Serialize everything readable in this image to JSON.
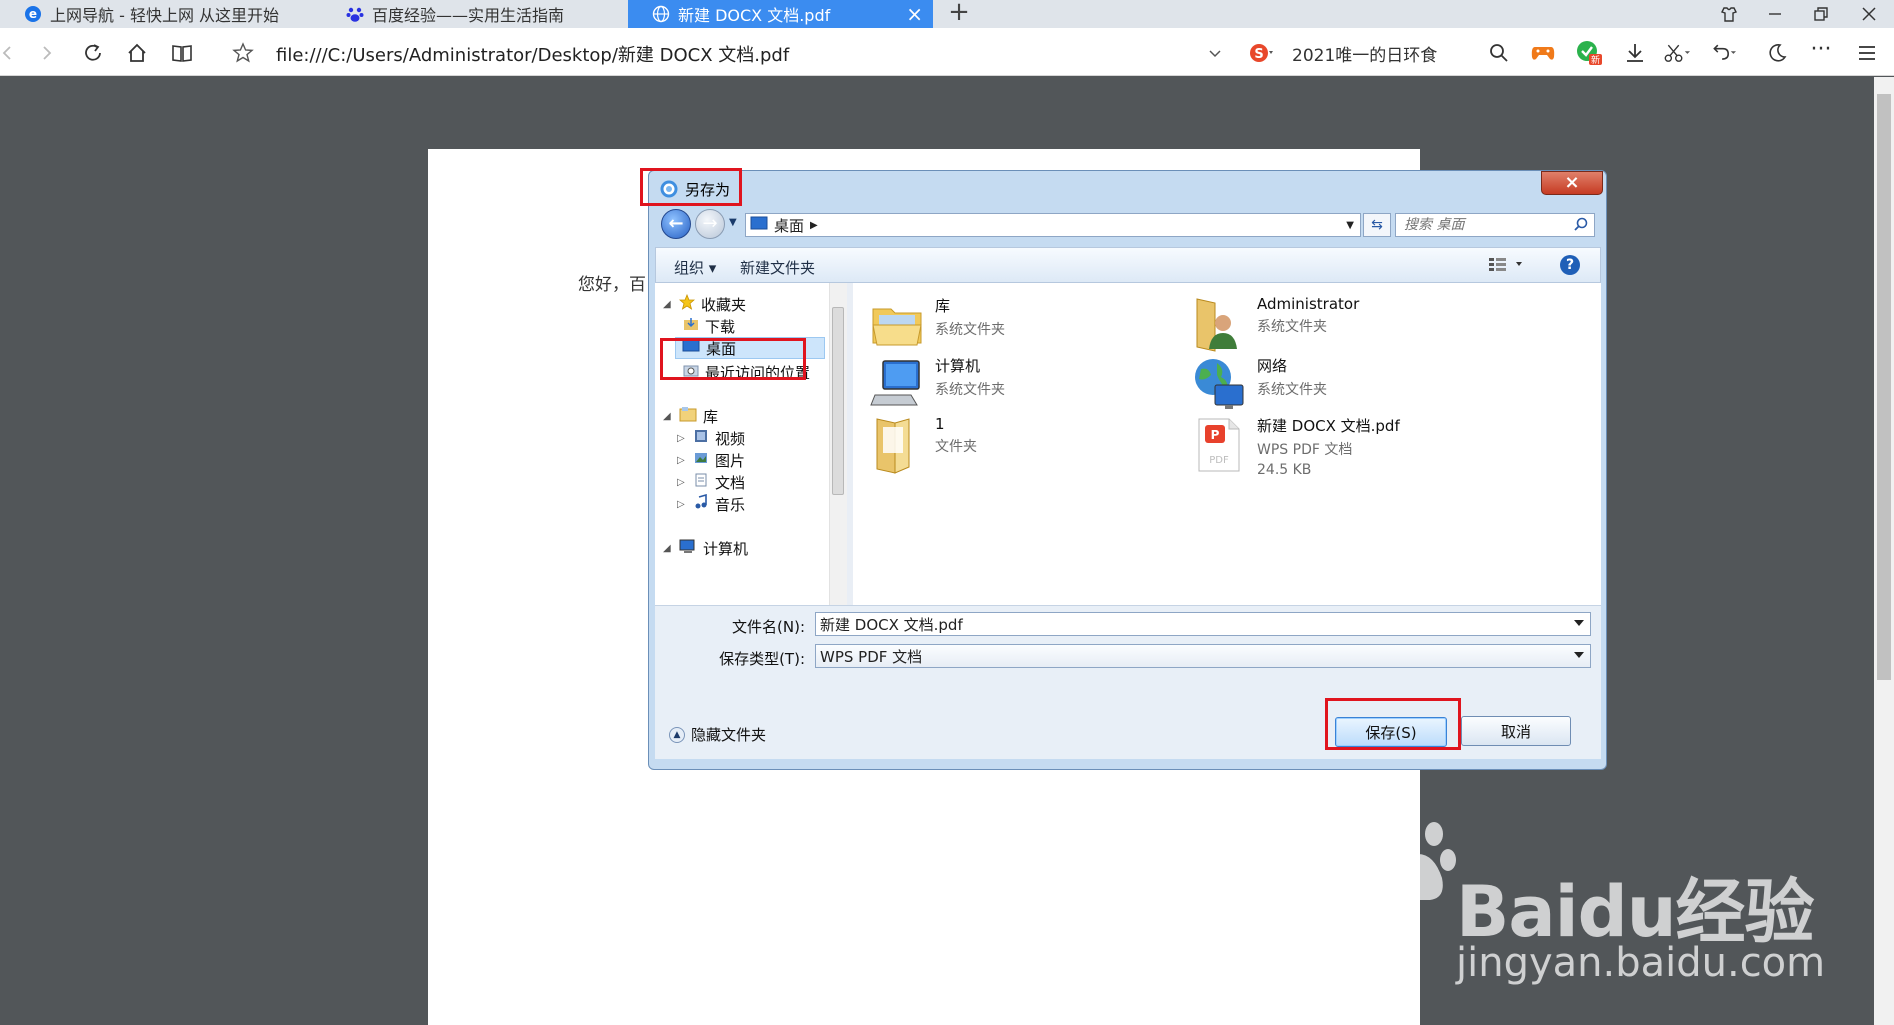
{
  "browser": {
    "tabs": [
      {
        "label": "上网导航 - 轻快上网 从这里开始"
      },
      {
        "label": "百度经验——实用生活指南"
      },
      {
        "label": "新建 DOCX 文档.pdf"
      }
    ],
    "new_tab": "+",
    "url": "file:///C:/Users/Administrator/Desktop/新建 DOCX 文档.pdf",
    "search_text": "2021唯一的日环食",
    "ellipsis": "···"
  },
  "page": {
    "text_fragment": "您好，百"
  },
  "dialog": {
    "title": "另存为",
    "close": "×",
    "path": "桌面",
    "search_placeholder": "搜索 桌面",
    "toolbar": {
      "organize": "组织 ▾",
      "new_folder": "新建文件夹",
      "help": "?"
    },
    "nav": [
      {
        "label": "收藏夹"
      },
      {
        "label": "下载"
      },
      {
        "label": "桌面"
      },
      {
        "label": "最近访问的位置"
      },
      {
        "label": "库"
      },
      {
        "label": "视频"
      },
      {
        "label": "图片"
      },
      {
        "label": "文档"
      },
      {
        "label": "音乐"
      },
      {
        "label": "计算机"
      }
    ],
    "files": [
      {
        "name": "库",
        "type": "系统文件夹"
      },
      {
        "name": "Administrator",
        "type": "系统文件夹"
      },
      {
        "name": "计算机",
        "type": "系统文件夹"
      },
      {
        "name": "网络",
        "type": "系统文件夹"
      },
      {
        "name": "1",
        "type": "文件夹"
      },
      {
        "name": "新建 DOCX 文档.pdf",
        "type": "WPS PDF 文档",
        "size": "24.5 KB"
      }
    ],
    "filename_label": "文件名(N):",
    "filename_value": "新建 DOCX 文档.pdf",
    "filetype_label": "保存类型(T):",
    "filetype_value": "WPS PDF 文档",
    "hide_folders": "隐藏文件夹",
    "save": "保存(S)",
    "cancel": "取消"
  },
  "watermark": {
    "brand": "Bai",
    "suffix": "du经验",
    "url": "jingyan.baidu.com"
  }
}
